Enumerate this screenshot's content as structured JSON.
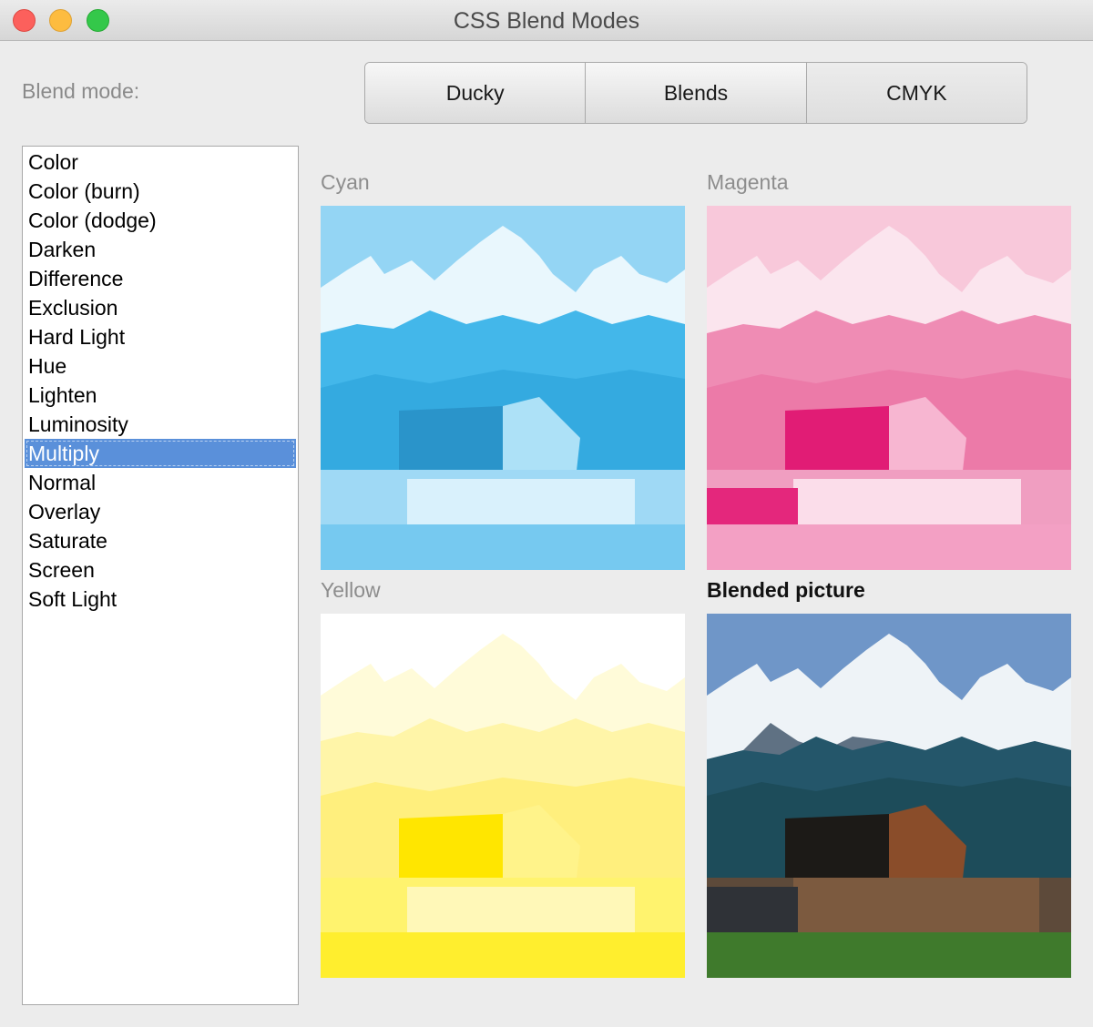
{
  "window": {
    "title": "CSS Blend Modes"
  },
  "controls": {
    "blend_mode_label": "Blend mode:",
    "tabs": [
      {
        "label": "Ducky",
        "selected": false
      },
      {
        "label": "Blends",
        "selected": false
      },
      {
        "label": "CMYK",
        "selected": true
      }
    ]
  },
  "blend_modes": {
    "items": [
      "Color",
      "Color (burn)",
      "Color (dodge)",
      "Darken",
      "Difference",
      "Exclusion",
      "Hard Light",
      "Hue",
      "Lighten",
      "Luminosity",
      "Multiply",
      "Normal",
      "Overlay",
      "Saturate",
      "Screen",
      "Soft Light"
    ],
    "selected": "Multiply"
  },
  "panels": {
    "cyan": {
      "label": "Cyan",
      "color": "#2bb0e8"
    },
    "magenta": {
      "label": "Magenta",
      "color": "#ea3f8e"
    },
    "yellow": {
      "label": "Yellow",
      "color": "#fff200"
    },
    "blended": {
      "label": "Blended picture"
    }
  }
}
